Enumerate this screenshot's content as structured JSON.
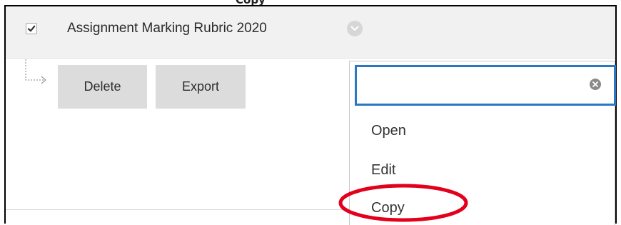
{
  "top_caption": {
    "text": "                              Copy"
  },
  "item": {
    "title": "Assignment Marking Rubric 2020",
    "checked": true
  },
  "actions": {
    "delete_label": "Delete",
    "export_label": "Export"
  },
  "context_menu": {
    "search_value": "",
    "items": [
      {
        "label": "Open"
      },
      {
        "label": "Edit"
      },
      {
        "label": "Copy"
      }
    ]
  },
  "colors": {
    "highlight": "#e3001b",
    "search_border": "#2b78c2",
    "row_background": "#f1f1f1",
    "button_background": "#dcdcdc"
  },
  "icons": [
    "checkmark-icon",
    "chevron-down-icon",
    "connector-arrow-icon",
    "clear-icon"
  ]
}
